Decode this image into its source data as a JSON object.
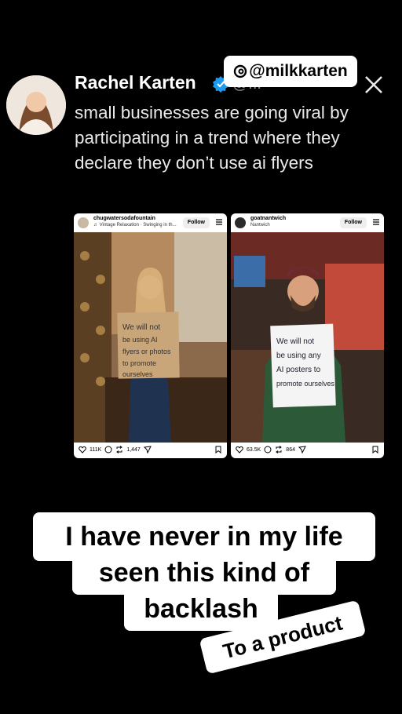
{
  "tweet": {
    "author_name": "Rachel Karten",
    "handle": "@...",
    "text": "small businesses are going viral by participating in a trend where they declare they don’t use ai flyers",
    "brand_icon": "x-logo"
  },
  "sticker_handle": "@milkkarten",
  "posts": [
    {
      "username": "chugwatersodafountain",
      "subtitle": "♬ Vintage Relaxation · Swinging in th...",
      "follow_label": "Follow",
      "sign_text": "We will not be using AI flyers or photos to promote ourselves",
      "likes": "111K",
      "reposts": "1,447"
    },
    {
      "username": "goatnantwich",
      "subtitle": "Nantwich",
      "follow_label": "Follow",
      "sign_text": "We will not be using any AI posters to promote ourselves",
      "likes": "63.5K",
      "reposts": "864"
    }
  ],
  "caption": {
    "line1": "I have never in my life",
    "line2": "seen this kind of",
    "line3": "backlash",
    "sticker": "To a product"
  },
  "colors": {
    "background": "#000000",
    "verified": "#1d9bf0",
    "caption_bg": "#ffffff"
  }
}
